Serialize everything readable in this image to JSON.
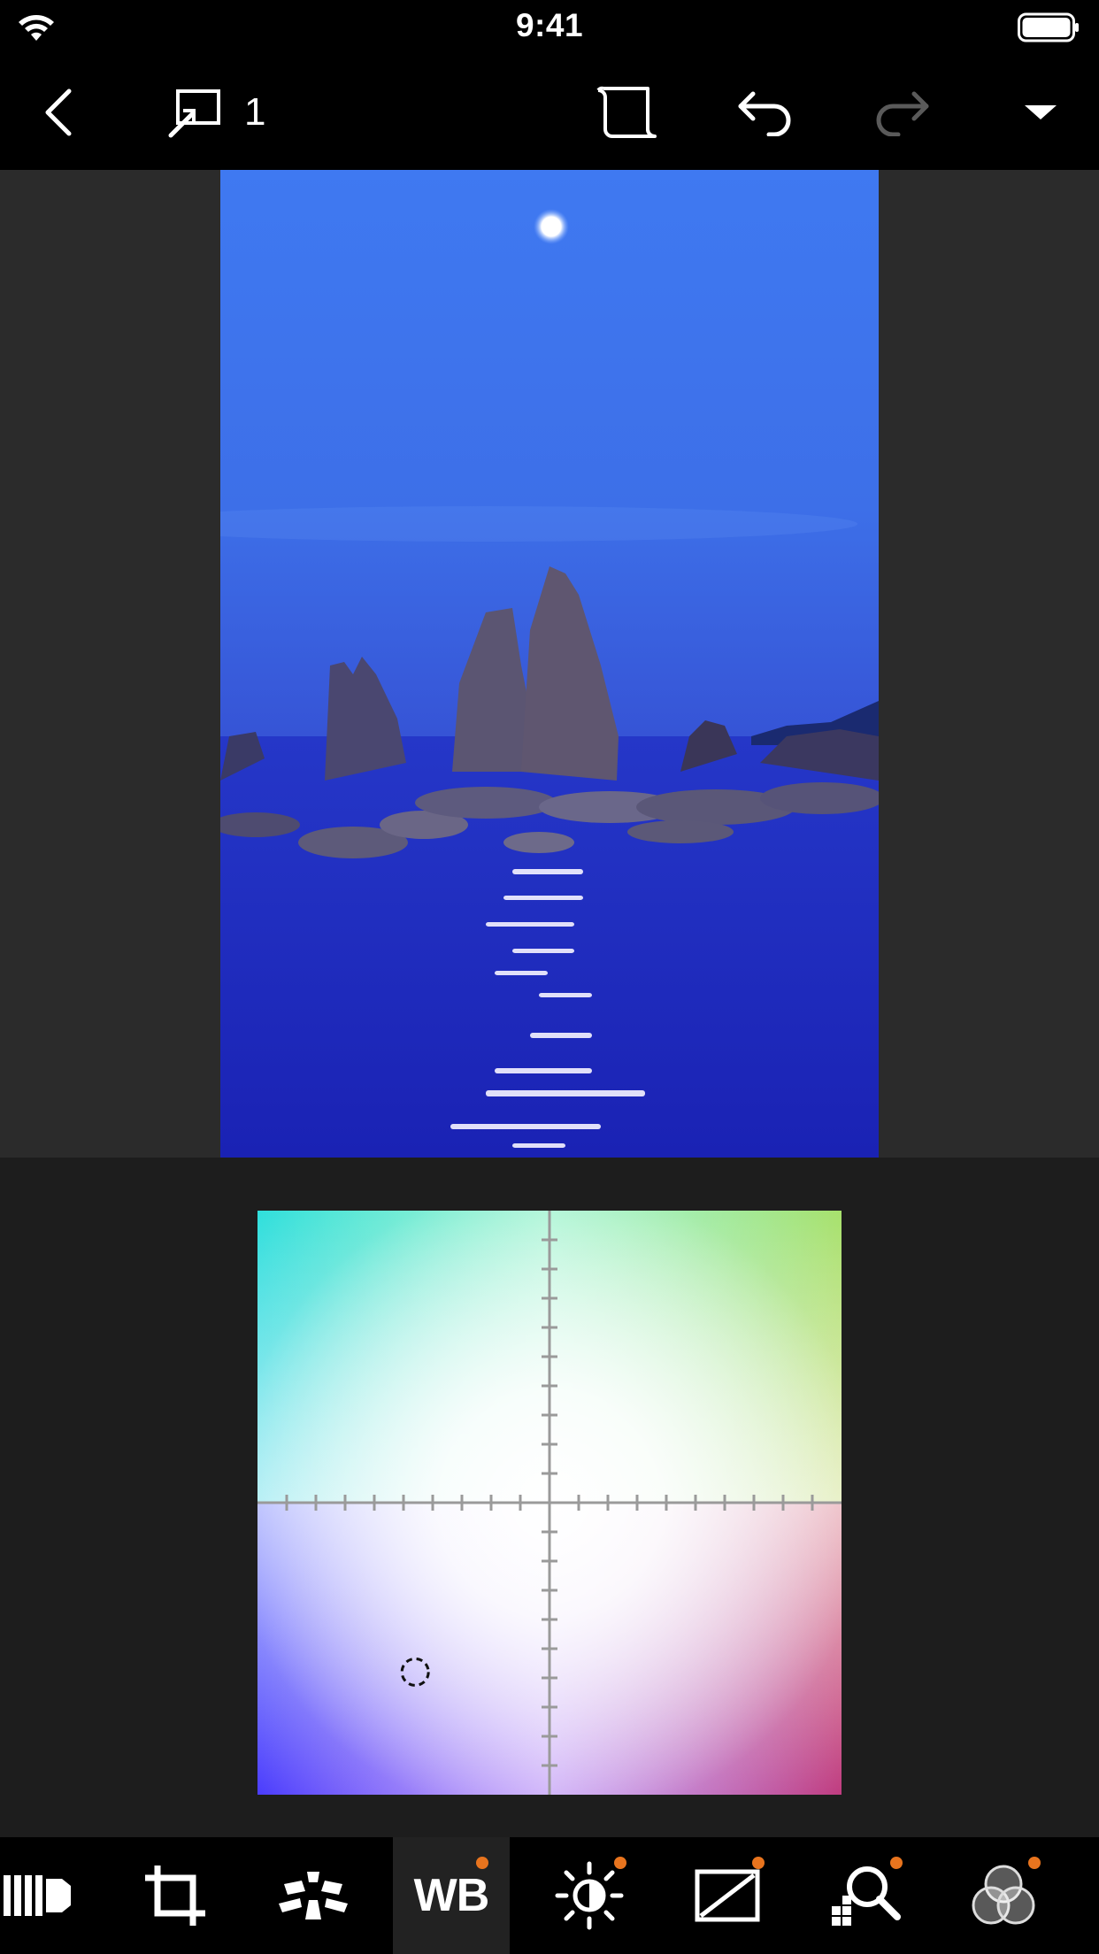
{
  "status_bar": {
    "time": "9:41"
  },
  "toolbar": {
    "image_count": "1"
  },
  "wb": {
    "picker_x": 0.27,
    "picker_y": 0.79
  },
  "tabs": [
    {
      "name": "presets",
      "icon": "presets-icon"
    },
    {
      "name": "crop",
      "icon": "crop-icon"
    },
    {
      "name": "auto",
      "icon": "auto-adjust-icon"
    },
    {
      "name": "white-balance",
      "label": "WB",
      "active": true,
      "modified": true
    },
    {
      "name": "brightness",
      "icon": "brightness-icon",
      "modified": true
    },
    {
      "name": "tone-curve",
      "icon": "tone-curve-icon",
      "modified": true
    },
    {
      "name": "detail",
      "icon": "detail-icon",
      "modified": true
    },
    {
      "name": "color",
      "icon": "color-icon",
      "modified": true
    }
  ],
  "colors": {
    "accent": "#e8741e"
  }
}
